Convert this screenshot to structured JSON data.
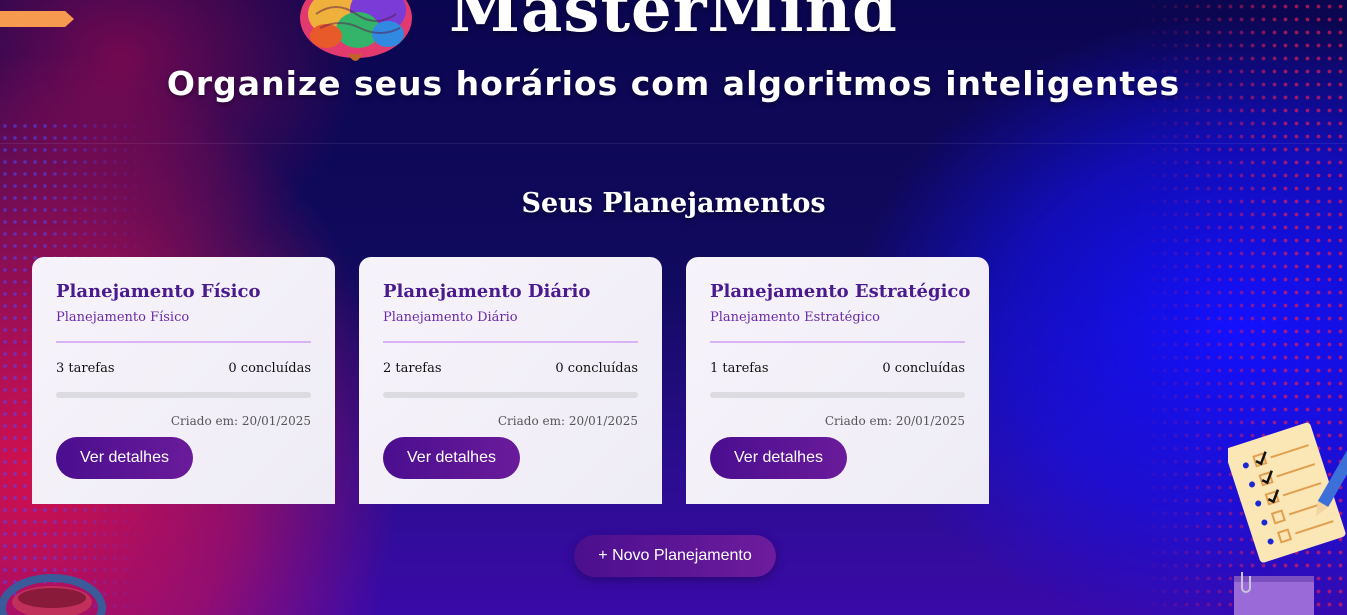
{
  "header": {
    "app_title": "MasterMind",
    "subtitle": "Organize seus horários com algoritmos inteligentes"
  },
  "main": {
    "section_title": "Seus Planejamentos",
    "cards": [
      {
        "title": "Planejamento Físico",
        "description": "Planejamento Físico",
        "tasks_label": "3 tarefas",
        "completed_label": "0 concluídas",
        "progress": 0,
        "created_label": "Criado em: 20/01/2025",
        "button_label": "Ver detalhes"
      },
      {
        "title": "Planejamento Diário",
        "description": "Planejamento Diário",
        "tasks_label": "2 tarefas",
        "completed_label": "0 concluídas",
        "progress": 0,
        "created_label": "Criado em: 20/01/2025",
        "button_label": "Ver detalhes"
      },
      {
        "title": "Planejamento Estratégico",
        "description": "Planejamento Estratégico",
        "tasks_label": "1 tarefas",
        "completed_label": "0 concluídas",
        "progress": 0,
        "created_label": "Criado em: 20/01/2025",
        "button_label": "Ver detalhes"
      }
    ],
    "new_button_label": "+ Novo Planejamento"
  },
  "icons": {
    "logo": "brain-icon",
    "decor_right": "checklist-icon",
    "decor_bottom_right": "notebook-icon",
    "decor_bottom_left": "paper-clip-icon"
  },
  "colors": {
    "accent": "#5b1596",
    "card_title": "#4a1a8f",
    "divider": "#d8b4f4",
    "tab_orange": "#f59a4e"
  }
}
